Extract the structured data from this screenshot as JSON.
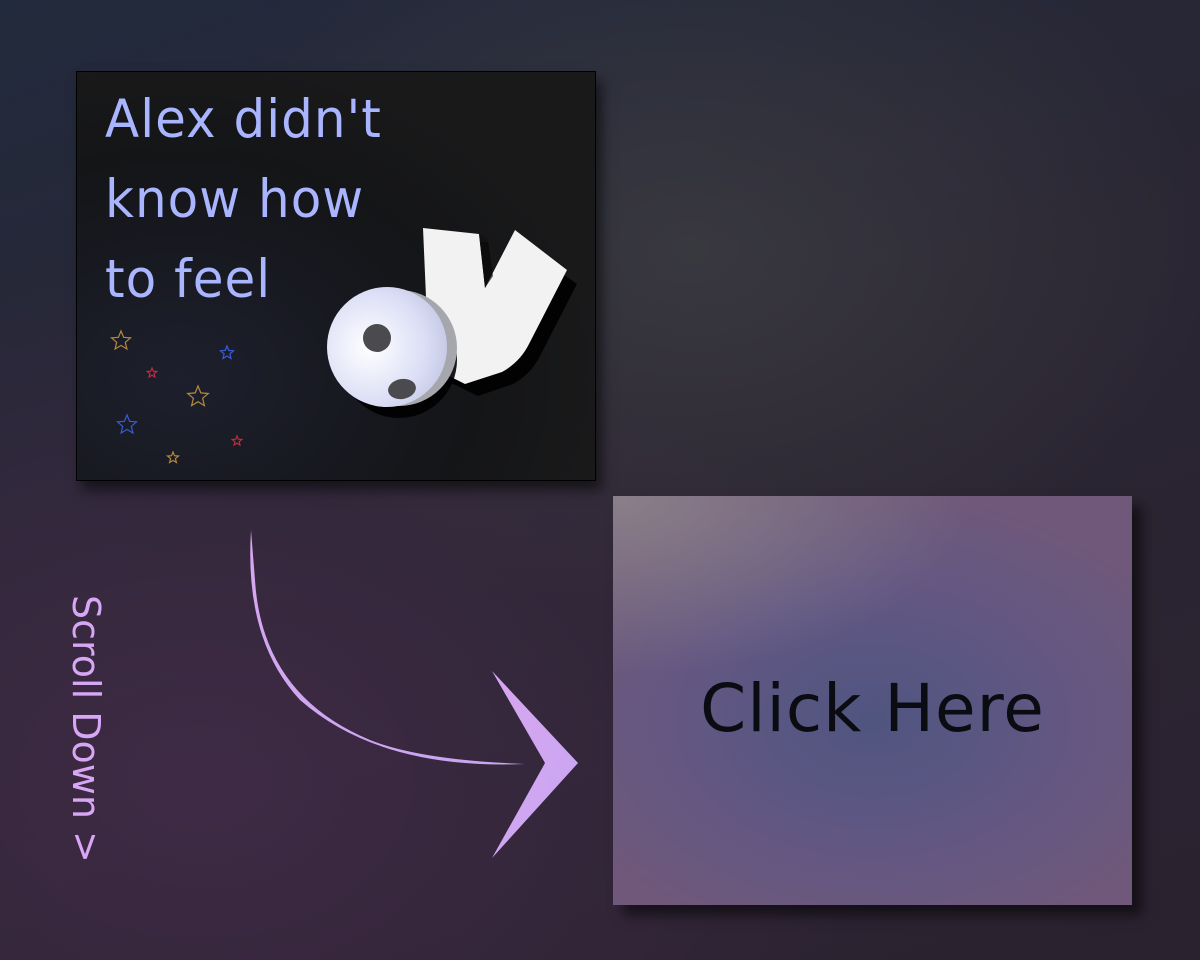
{
  "story_card": {
    "title_lines": [
      "Alex didn't",
      "know how",
      "to feel"
    ]
  },
  "cta": {
    "label": "Click Here"
  },
  "scroll_hint": {
    "label": "Scroll Down >"
  },
  "colors": {
    "title_text": "#a9b5ff",
    "hint_text": "#d7a6f5",
    "arrow": "#d5a8f1",
    "cta_text": "#0b0b12"
  },
  "icons": {
    "figure": "falling-person-icon",
    "stars": "star-icon",
    "arrow": "curved-arrow-icon"
  }
}
